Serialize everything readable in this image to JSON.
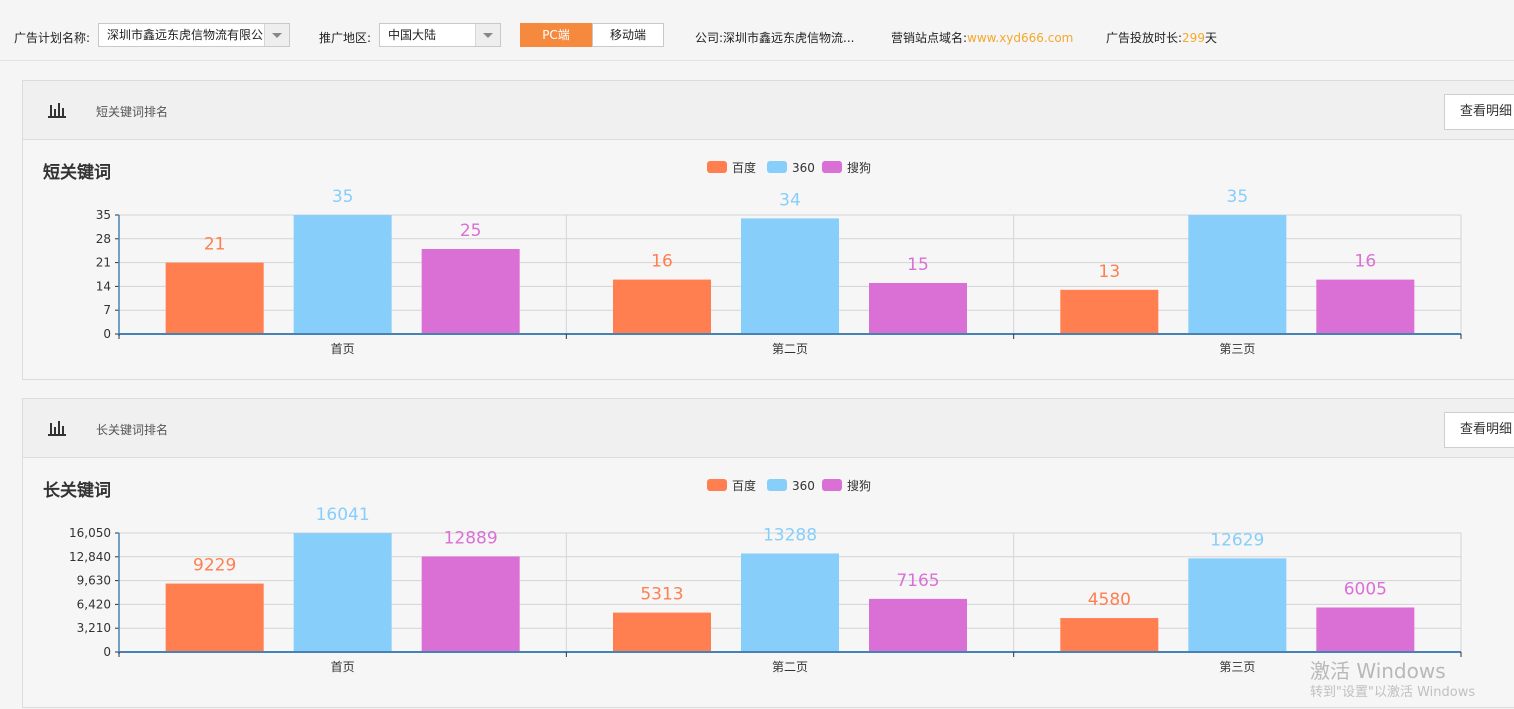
{
  "topbar": {
    "plan_label": "广告计划名称:",
    "plan_value": "深圳市鑫远东虎信物流有限公",
    "region_label": "推广地区:",
    "region_value": "中国大陆",
    "pc_label": "PC端",
    "mobile_label": "移动端",
    "company_label": "公司:",
    "company_value": "深圳市鑫远东虎信物流...",
    "domain_label": "营销站点域名:",
    "domain_value": "www.xyd666.com",
    "duration_label": "广告投放时长:",
    "duration_value": "299",
    "duration_unit": "天"
  },
  "panels": [
    {
      "header_title": "短关键词排名",
      "detail_button": "查看明细"
    },
    {
      "header_title": "长关键词排名",
      "detail_button": "查看明细"
    }
  ],
  "colors": {
    "baidu": "#ff7f50",
    "s360": "#87cefa",
    "sogou": "#da70d6",
    "accent": "#f58a3e"
  },
  "icons": {
    "chart": "bar-chart-icon"
  },
  "watermark": {
    "line1": "激活 Windows",
    "line2": "转到\"设置\"以激活 Windows"
  },
  "chart_data": [
    {
      "type": "bar",
      "title": "短关键词",
      "categories": [
        "首页",
        "第二页",
        "第三页"
      ],
      "series": [
        {
          "name": "百度",
          "values": [
            21,
            16,
            13
          ]
        },
        {
          "name": "360",
          "values": [
            35,
            34,
            35
          ]
        },
        {
          "name": "搜狗",
          "values": [
            25,
            15,
            16
          ]
        }
      ],
      "yticks": [
        "0",
        "7",
        "14",
        "21",
        "28",
        "35"
      ],
      "ylim": [
        0,
        35
      ],
      "grid": true,
      "legend": "top-center"
    },
    {
      "type": "bar",
      "title": "长关键词",
      "categories": [
        "首页",
        "第二页",
        "第三页"
      ],
      "series": [
        {
          "name": "百度",
          "values": [
            9229,
            5313,
            4580
          ]
        },
        {
          "name": "360",
          "values": [
            16041,
            13288,
            12629
          ]
        },
        {
          "name": "搜狗",
          "values": [
            12889,
            7165,
            6005
          ]
        }
      ],
      "yticks": [
        "0",
        "3,210",
        "6,420",
        "9,630",
        "12,840",
        "16,050"
      ],
      "ylim": [
        0,
        16050
      ],
      "grid": true,
      "legend": "top-center"
    }
  ]
}
